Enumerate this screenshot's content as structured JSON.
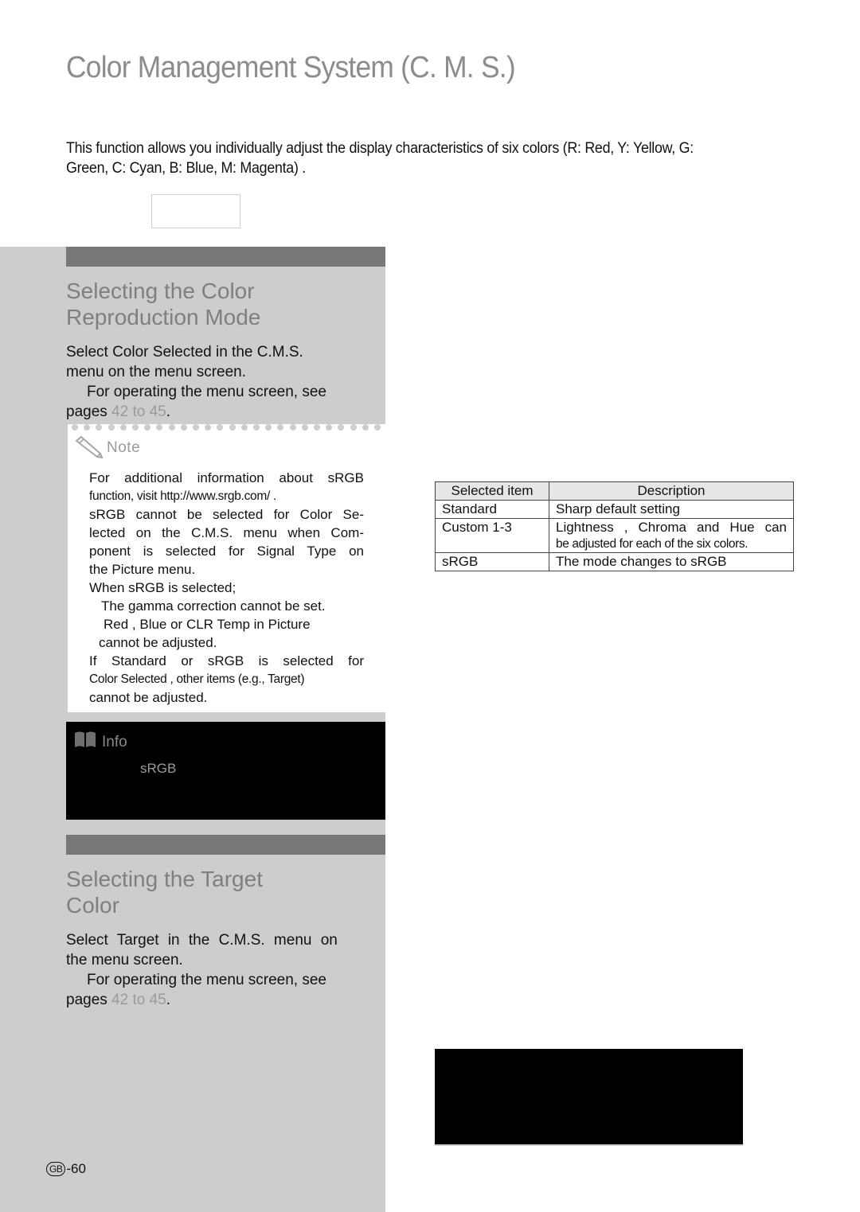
{
  "page": {
    "title": "Color Management System (C. M. S.)",
    "intro": "This function allows you individually adjust the display characteristics of six colors (R: Red, Y: Yellow, G: Green, C: Cyan, B: Blue, M: Magenta) ."
  },
  "section1": {
    "heading_line1": "Selecting the Color",
    "heading_line2": "Reproduction Mode",
    "step_line1": "Select  Color Selected  in the  C.M.S.",
    "step_line2": "menu on the menu screen.",
    "ref_line1": "For operating the menu screen, see",
    "ref_prefix": "pages ",
    "ref_pages": "42 to 45",
    "ref_suffix": "."
  },
  "note": {
    "label": "Note",
    "icon": "pencil-icon",
    "lines": [
      "For additional information about sRGB",
      "function, visit  http://www.srgb.com/ .",
      " sRGB  cannot be selected for  Color Se-",
      "lected  on the C.M.S. menu when  Com-",
      "ponent  is selected for  Signal Type  on",
      "the  Picture  menu.",
      "When  sRGB  is selected;",
      "The gamma correction cannot be set.",
      " Red ,  Blue  or  CLR Temp  in  Picture",
      "cannot be adjusted.",
      "If  Standard  or  sRGB  is selected for",
      " Color Selected , other items (e.g., Target)",
      "cannot be adjusted."
    ]
  },
  "info": {
    "label": "Info",
    "icon": "book-icon",
    "text": "sRGB"
  },
  "table": {
    "headers": [
      "Selected item",
      "Description"
    ],
    "rows": [
      {
        "item": "Standard",
        "desc": "Sharp default setting",
        "desc2": ""
      },
      {
        "item": "Custom 1-3",
        "desc": " Lightness ,  Chroma  and  Hue  can",
        "desc2": "be adjusted for each of the six colors."
      },
      {
        "item": "sRGB",
        "desc": "The mode changes to sRGB",
        "desc2": ""
      }
    ]
  },
  "section2": {
    "heading_line1": "Selecting the Target",
    "heading_line2": "Color",
    "step_line1": "Select   Target   in the    C.M.S.   menu on",
    "step_line2": "the menu screen.",
    "ref_line1": "For operating the menu screen, see",
    "ref_prefix": "pages ",
    "ref_pages": "42 to 45",
    "ref_suffix": "."
  },
  "footer": {
    "region_badge": "GB",
    "page_number": "-60"
  }
}
